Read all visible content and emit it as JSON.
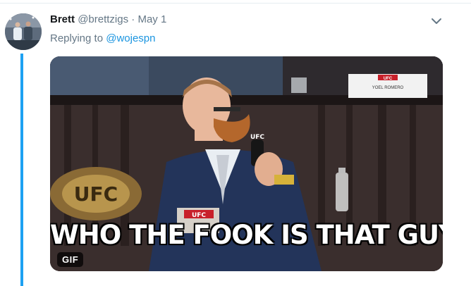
{
  "tweet": {
    "display_name": "Brett",
    "handle": "@brettzigs",
    "separator": "·",
    "date": "May 1",
    "replying_prefix": "Replying to",
    "replying_to": "@wojespn"
  },
  "media": {
    "caption": "WHO THE FOOK IS THAT GUY???",
    "badge": "GIF",
    "placard_name": "YOEL ROMERO",
    "placard_logo": "UFC",
    "mic_logo": "UFC",
    "belt_logo": "UFC",
    "podium_logo": "UFC"
  },
  "icons": {
    "menu": "chevron-down-icon"
  },
  "colors": {
    "link": "#1b95e0",
    "thread_line": "#1da1f2",
    "secondary_text": "#657786",
    "name_text": "#14171a"
  }
}
